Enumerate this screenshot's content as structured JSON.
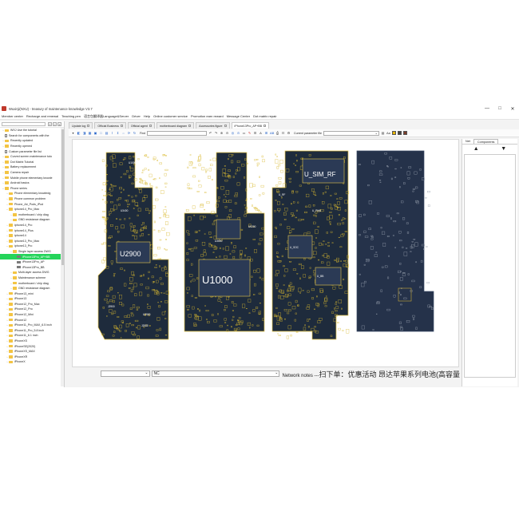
{
  "window": {
    "title": "Wuxinji(NXU) - treasury of maintenance knowledge V3.7",
    "minimize": "—",
    "maximize": "□",
    "close": "✕"
  },
  "menu": [
    "Member center",
    "Recharge and renewal",
    "Teaching pen",
    "语言包翻译器Language&Server",
    "Driver",
    "Help",
    "Online customer service",
    "Promotion earn reward",
    "Message Center",
    "Dot matrix repair"
  ],
  "tree": {
    "items": [
      {
        "label": "WXJ Use the tutorial",
        "level": 0,
        "icon": "folder",
        "exp": "›"
      },
      {
        "label": "Search for components with the",
        "level": 0,
        "icon": "search",
        "exp": ""
      },
      {
        "label": "Recently updated",
        "level": 0,
        "icon": "folder",
        "exp": "›"
      },
      {
        "label": "Recently opened",
        "level": 0,
        "icon": "folder",
        "exp": "›"
      },
      {
        "label": "Custom parameter file list",
        "level": 0,
        "icon": "doc",
        "exp": ""
      },
      {
        "label": "Curved screen maintenance tuto",
        "level": 0,
        "icon": "folder",
        "exp": "›"
      },
      {
        "label": "Dot Matrix Tutorial",
        "level": 0,
        "icon": "folder",
        "exp": "›"
      },
      {
        "label": "Battery replacement",
        "level": 0,
        "icon": "folder",
        "exp": "›"
      },
      {
        "label": "Camera repair",
        "level": 0,
        "icon": "folder",
        "exp": "›"
      },
      {
        "label": "Mobile phone elementary knowle",
        "level": 0,
        "icon": "folder",
        "exp": "›"
      },
      {
        "label": "Android basics",
        "level": 0,
        "icon": "folder",
        "exp": "›"
      },
      {
        "label": "Phone series",
        "level": 0,
        "icon": "folder",
        "exp": "⌄"
      },
      {
        "label": "Phone elementary knowledg",
        "level": 1,
        "icon": "folder",
        "exp": "›"
      },
      {
        "label": "Phone common problem",
        "level": 1,
        "icon": "folder",
        "exp": "›"
      },
      {
        "label": "Phone_Air_Pods_iPod",
        "level": 1,
        "icon": "folder",
        "exp": "›"
      },
      {
        "label": "iphone14_Pro_Max",
        "level": 1,
        "icon": "folder",
        "exp": "⌄"
      },
      {
        "label": "motherboard / chip diag",
        "level": 2,
        "icon": "folder",
        "exp": "›"
      },
      {
        "label": "GND resistance diagram",
        "level": 2,
        "icon": "folder",
        "exp": "›"
      },
      {
        "label": "iphone14_Pro",
        "level": 1,
        "icon": "folder",
        "exp": "›"
      },
      {
        "label": "iphone14_Plus",
        "level": 1,
        "icon": "folder",
        "exp": "›"
      },
      {
        "label": "iphone14",
        "level": 1,
        "icon": "folder",
        "exp": "›"
      },
      {
        "label": "iphone13_Pro_Max",
        "level": 1,
        "icon": "folder",
        "exp": "›"
      },
      {
        "label": "iphone13_Pro",
        "level": 1,
        "icon": "folder",
        "exp": "⌄"
      },
      {
        "label": "Single layer access DWG",
        "level": 2,
        "icon": "folder",
        "exp": "⌄"
      },
      {
        "label": "iPhone13Pro_AP+BB",
        "level": 3,
        "icon": "pcb",
        "exp": "",
        "selected": true
      },
      {
        "label": "iPhone13Pro_AP",
        "level": 3,
        "icon": "pcb",
        "exp": ""
      },
      {
        "label": "iPhone13Pro_BB",
        "level": 3,
        "icon": "pcb",
        "exp": ""
      },
      {
        "label": "Multi-layer access DWG",
        "level": 2,
        "icon": "folder",
        "exp": "›"
      },
      {
        "label": "Maintenance scheme",
        "level": 2,
        "icon": "folder",
        "exp": "›"
      },
      {
        "label": "motherboard / chip diag",
        "level": 2,
        "icon": "folder",
        "exp": "›"
      },
      {
        "label": "GND resistance diagram",
        "level": 2,
        "icon": "folder",
        "exp": "›"
      },
      {
        "label": "iPhone13_mini",
        "level": 1,
        "icon": "folder",
        "exp": "›"
      },
      {
        "label": "iPhone13",
        "level": 1,
        "icon": "folder",
        "exp": "›"
      },
      {
        "label": "iPhone12_Pro_Max",
        "level": 1,
        "icon": "folder",
        "exp": "›"
      },
      {
        "label": "iPhone12_Pro",
        "level": 1,
        "icon": "folder",
        "exp": "›"
      },
      {
        "label": "iPhone12_Mini",
        "level": 1,
        "icon": "folder",
        "exp": "›"
      },
      {
        "label": "iPhone12",
        "level": 1,
        "icon": "folder",
        "exp": "›"
      },
      {
        "label": "iPhone11_Pro_MAX_6.5 inch",
        "level": 1,
        "icon": "folder",
        "exp": "›"
      },
      {
        "label": "iPhone11_Pro_5.8 inch",
        "level": 1,
        "icon": "folder",
        "exp": "›"
      },
      {
        "label": "iPhone11_6.1 inch",
        "level": 1,
        "icon": "folder",
        "exp": "›"
      },
      {
        "label": "iPhoneXS",
        "level": 1,
        "icon": "folder",
        "exp": "›"
      },
      {
        "label": "iPhoneSE(2020)",
        "level": 1,
        "icon": "folder",
        "exp": "›"
      },
      {
        "label": "iPhoneXS_MAX",
        "level": 1,
        "icon": "folder",
        "exp": "›"
      },
      {
        "label": "iPhoneXR",
        "level": 1,
        "icon": "folder",
        "exp": "›"
      },
      {
        "label": "iPhoneX",
        "level": 1,
        "icon": "folder",
        "exp": "›"
      }
    ]
  },
  "tabs": [
    {
      "label": "Update log",
      "active": false
    },
    {
      "label": "Official Business",
      "active": false
    },
    {
      "label": "Official agent",
      "active": false
    },
    {
      "label": "motherboard diagram",
      "active": false
    },
    {
      "label": "Accessories figure",
      "active": false
    },
    {
      "label": "iPhone13Pro_AP+BB",
      "active": true
    }
  ],
  "toolbar": {
    "find_label": "Find",
    "cp_label": "Current parameter file",
    "ab_label": "AB"
  },
  "board": {
    "labels": {
      "u2900": "U2900",
      "u1000": "U1000",
      "u_sim_rf": "U_SIM_RF",
      "small": [
        "U1000",
        "U2900",
        "U3600",
        "U5200",
        "U3400",
        "U_SOC",
        "U_PMU",
        "U_RF",
        "U_BB",
        "J2000",
        "J2900",
        "U4500"
      ]
    },
    "colors": {
      "board": "#1e2b3c",
      "outline": "#e6c64a",
      "pad": "#d9b92f",
      "text": "#ffffff",
      "back": "#25324a"
    }
  },
  "right_panel": {
    "tab_net": "Net",
    "tab_components": "Components",
    "up": "▲",
    "down": "▼"
  },
  "bottom": {
    "select1": "",
    "select2": "NC",
    "notes_prefix": "Network notes ---",
    "notes_cn": "扫下单：优惠活动 昂达苹果系列电池(高容量"
  }
}
